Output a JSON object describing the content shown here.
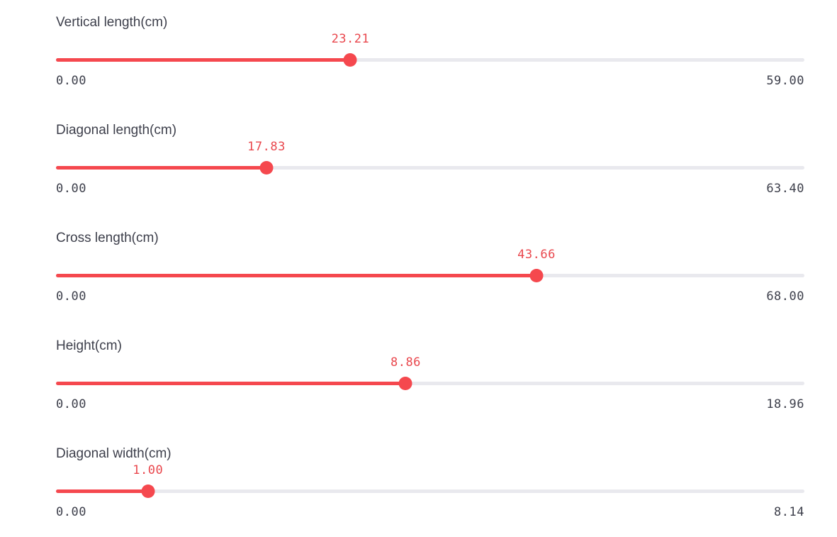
{
  "accent_color": "#f5484e",
  "track_color": "#e9e9ee",
  "sliders": [
    {
      "label": "Vertical length(cm)",
      "value": "23.21",
      "min": "0.00",
      "max": "59.00"
    },
    {
      "label": "Diagonal length(cm)",
      "value": "17.83",
      "min": "0.00",
      "max": "63.40"
    },
    {
      "label": "Cross length(cm)",
      "value": "43.66",
      "min": "0.00",
      "max": "68.00"
    },
    {
      "label": "Height(cm)",
      "value": "8.86",
      "min": "0.00",
      "max": "18.96"
    },
    {
      "label": "Diagonal width(cm)",
      "value": "1.00",
      "min": "0.00",
      "max": "8.14"
    }
  ]
}
